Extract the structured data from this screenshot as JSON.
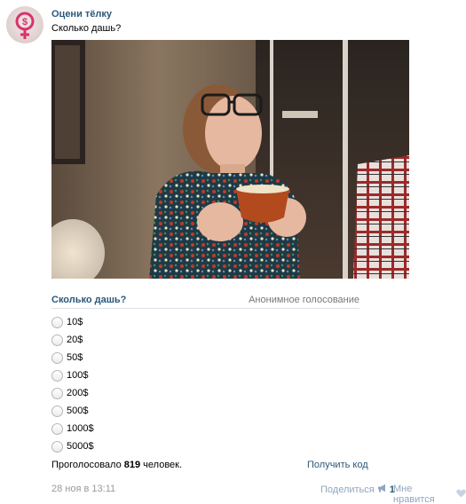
{
  "post": {
    "author": "Оцени тёлку",
    "text": "Сколько дашь?",
    "photo_alt": "photo"
  },
  "poll": {
    "question": "Сколько дашь?",
    "type": "Анонимное голосование",
    "options": [
      "10$",
      "20$",
      "50$",
      "100$",
      "200$",
      "500$",
      "1000$",
      "5000$"
    ],
    "votes_prefix": "Проголосовало",
    "votes_count": "819",
    "votes_suffix": "человек.",
    "get_code": "Получить код"
  },
  "footer": {
    "date": "28 ноя в 13:11",
    "share_label": "Поделиться",
    "share_count": "1",
    "like_label": "Мне нравится"
  },
  "colors": {
    "link": "#2b587a",
    "muted": "#999999",
    "action": "#8fa6bf",
    "divider": "#dae1e8"
  },
  "icons": {
    "avatar_symbol": "female-sign-icon",
    "share": "megaphone-icon",
    "like": "heart-icon"
  }
}
